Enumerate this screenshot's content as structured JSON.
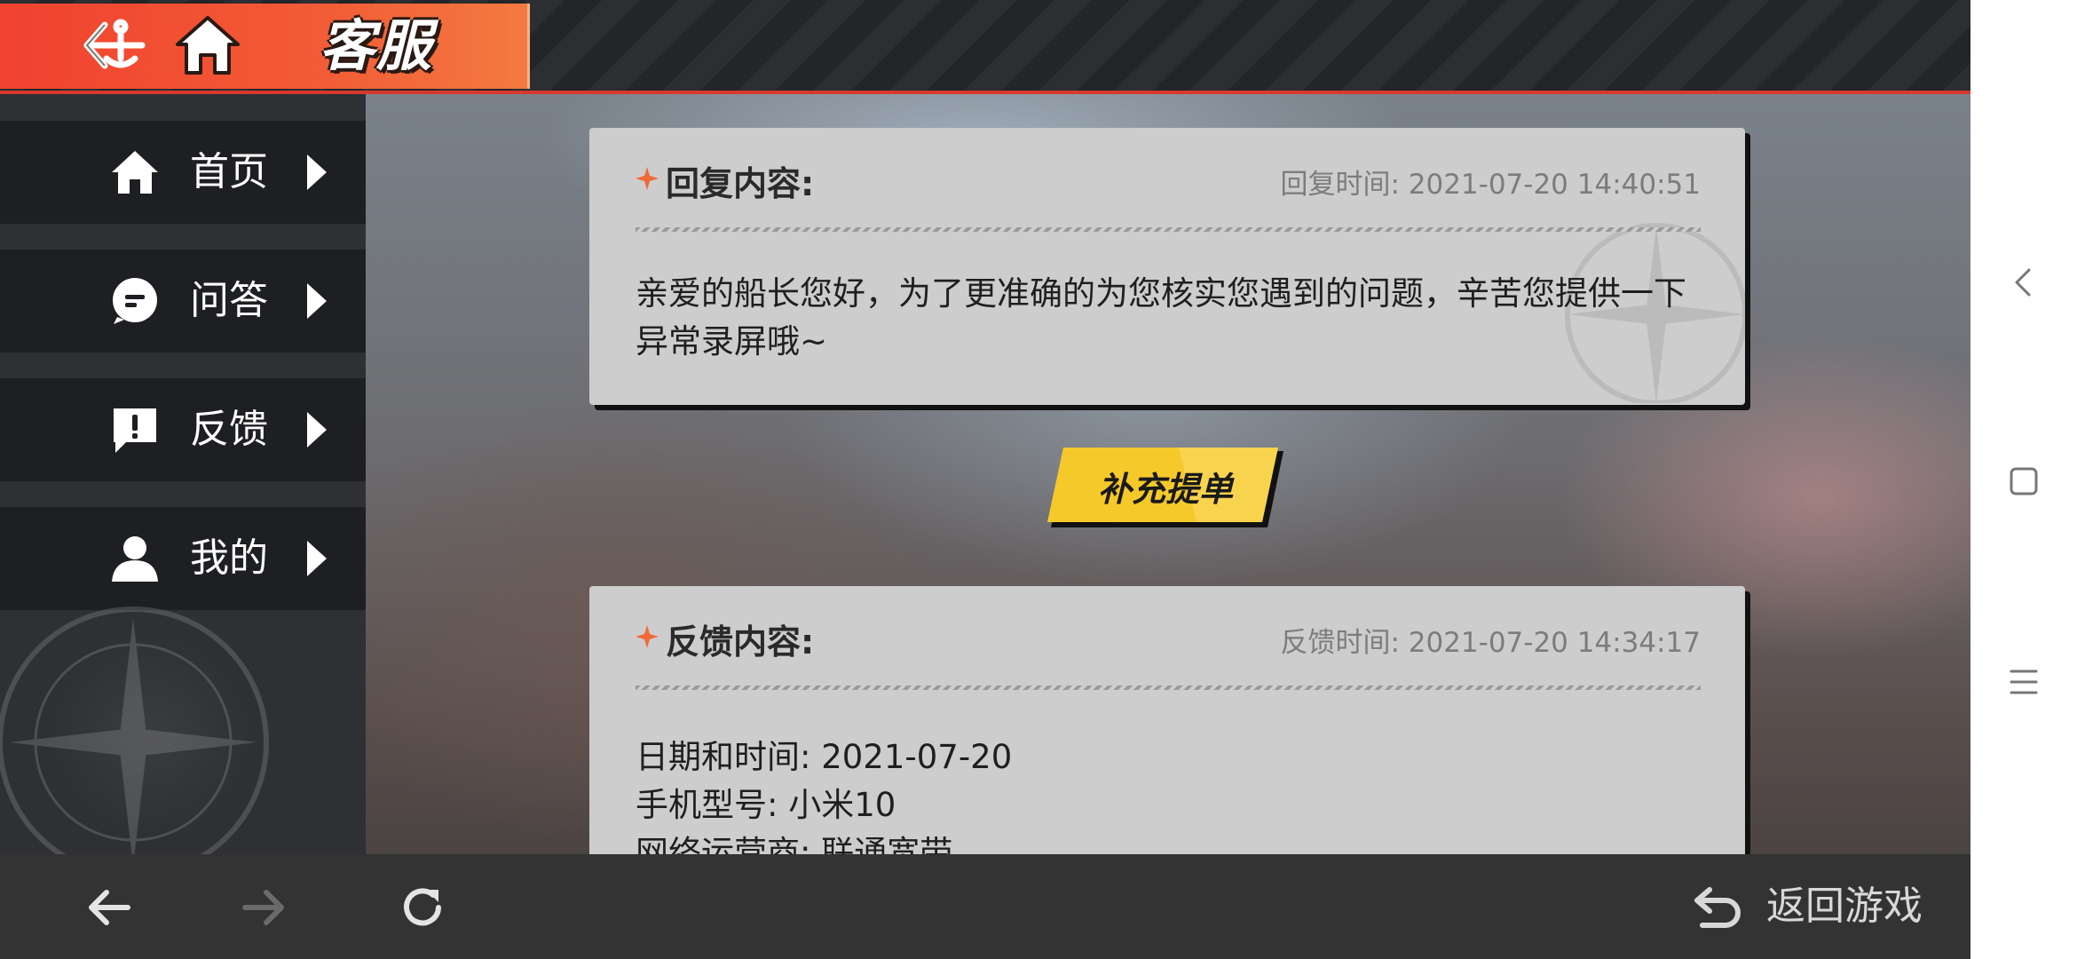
{
  "header": {
    "title": "客服"
  },
  "sidebar": {
    "items": [
      {
        "label": "首页",
        "icon": "home-icon"
      },
      {
        "label": "问答",
        "icon": "chat-bubble-icon"
      },
      {
        "label": "反馈",
        "icon": "feedback-exclamation-icon"
      },
      {
        "label": "我的",
        "icon": "user-icon"
      }
    ]
  },
  "reply_card": {
    "heading": "回复内容:",
    "time": "回复时间: 2021-07-20 14:40:51",
    "body": "亲爱的船长您好，为了更准确的为您核实您遇到的问题，辛苦您提供一下异常录屏哦~"
  },
  "supplement_button": {
    "label": "补充提单"
  },
  "feedback_card": {
    "heading": "反馈内容:",
    "time": "反馈时间: 2021-07-20 14:34:17",
    "lines": [
      "日期和时间: 2021-07-20",
      "手机型号: 小米10",
      "网络运营商: 联通宽带"
    ]
  },
  "bottom_bar": {
    "return_label": "返回游戏"
  },
  "colors": {
    "title_tab": "#f0422f",
    "accent_red": "#d8382d",
    "button_yellow": "#f6c92a",
    "card_bg": "#cdcdcd"
  }
}
